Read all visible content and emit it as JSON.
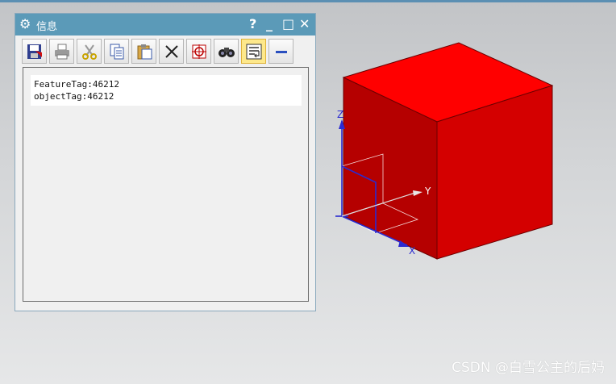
{
  "window": {
    "title": "信息",
    "controls": {
      "help": "?",
      "minimize": "_",
      "maximize": "□",
      "close": "✕"
    }
  },
  "toolbar": {
    "buttons": [
      {
        "icon": "save-icon"
      },
      {
        "icon": "print-icon"
      },
      {
        "icon": "cut-icon"
      },
      {
        "icon": "copy-icon"
      },
      {
        "icon": "paste-icon"
      },
      {
        "icon": "delete-icon"
      },
      {
        "icon": "crosshair-icon"
      },
      {
        "icon": "binoculars-icon"
      },
      {
        "icon": "word-wrap-icon",
        "active": true
      },
      {
        "icon": "minus-icon"
      }
    ]
  },
  "info": {
    "lines": [
      "FeatureTag:46212",
      "objectTag:46212"
    ]
  },
  "scene": {
    "axes": {
      "x": "X",
      "y": "Y",
      "z": "Z"
    },
    "colors": {
      "cube_top": "#ff0000",
      "cube_front": "#b50000",
      "cube_right": "#d40000",
      "axis": "#2a2ad0"
    }
  },
  "watermark": "CSDN @白雪公主的后妈"
}
